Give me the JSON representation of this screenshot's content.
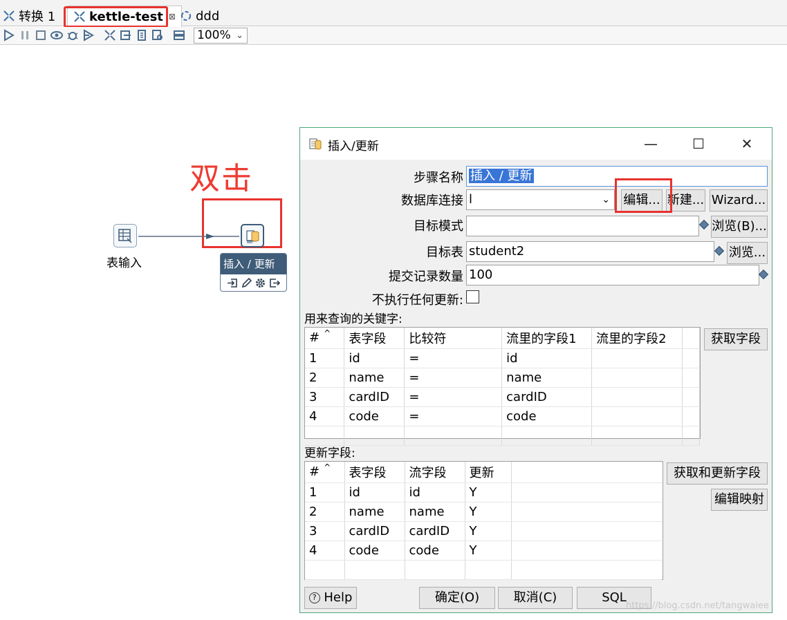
{
  "tabs": [
    {
      "label": "转换 1"
    },
    {
      "label": "kettle-test",
      "close": "⊠"
    },
    {
      "label": "ddd"
    }
  ],
  "toolbar": {
    "zoom": "100%"
  },
  "canvas": {
    "annotation": "双击",
    "step1_label": "表输入",
    "step2_tooltip": "插入 / 更新"
  },
  "dialog": {
    "title": "插入/更新",
    "labels": {
      "step_name": "步骤名称",
      "db_conn": "数据库连接",
      "target_schema": "目标模式",
      "target_table": "目标表",
      "commit_size": "提交记录数量",
      "no_update": "不执行任何更新:"
    },
    "values": {
      "step_name": "插入 / 更新",
      "db_conn": "l",
      "target_schema": "",
      "target_table": "student2",
      "commit_size": "100"
    },
    "buttons": {
      "edit": "编辑...",
      "new": "新建...",
      "wizard": "Wizard...",
      "browse_schema": "浏览(B)...",
      "browse_table": "浏览...",
      "get_fields": "获取字段",
      "get_update_fields": "获取和更新字段",
      "edit_mapping": "编辑映射",
      "help": "Help",
      "ok": "确定(O)",
      "cancel": "取消(C)",
      "sql": "SQL"
    },
    "key_section_label": "用来查询的关键字:",
    "key_table": {
      "headers": [
        "#",
        "表字段",
        "比较符",
        "流里的字段1",
        "流里的字段2"
      ],
      "rows": [
        [
          "1",
          "id",
          "=",
          "id",
          ""
        ],
        [
          "2",
          "name",
          "=",
          "name",
          ""
        ],
        [
          "3",
          "cardID",
          "=",
          "cardID",
          ""
        ],
        [
          "4",
          "code",
          "=",
          "code",
          ""
        ]
      ]
    },
    "update_section_label": "更新字段:",
    "update_table": {
      "headers": [
        "#",
        "表字段",
        "流字段",
        "更新"
      ],
      "rows": [
        [
          "1",
          "id",
          "id",
          "Y"
        ],
        [
          "2",
          "name",
          "name",
          "Y"
        ],
        [
          "3",
          "cardID",
          "cardID",
          "Y"
        ],
        [
          "4",
          "code",
          "code",
          "Y"
        ]
      ]
    }
  },
  "watermark": "https://blog.csdn.net/tangwaiee"
}
